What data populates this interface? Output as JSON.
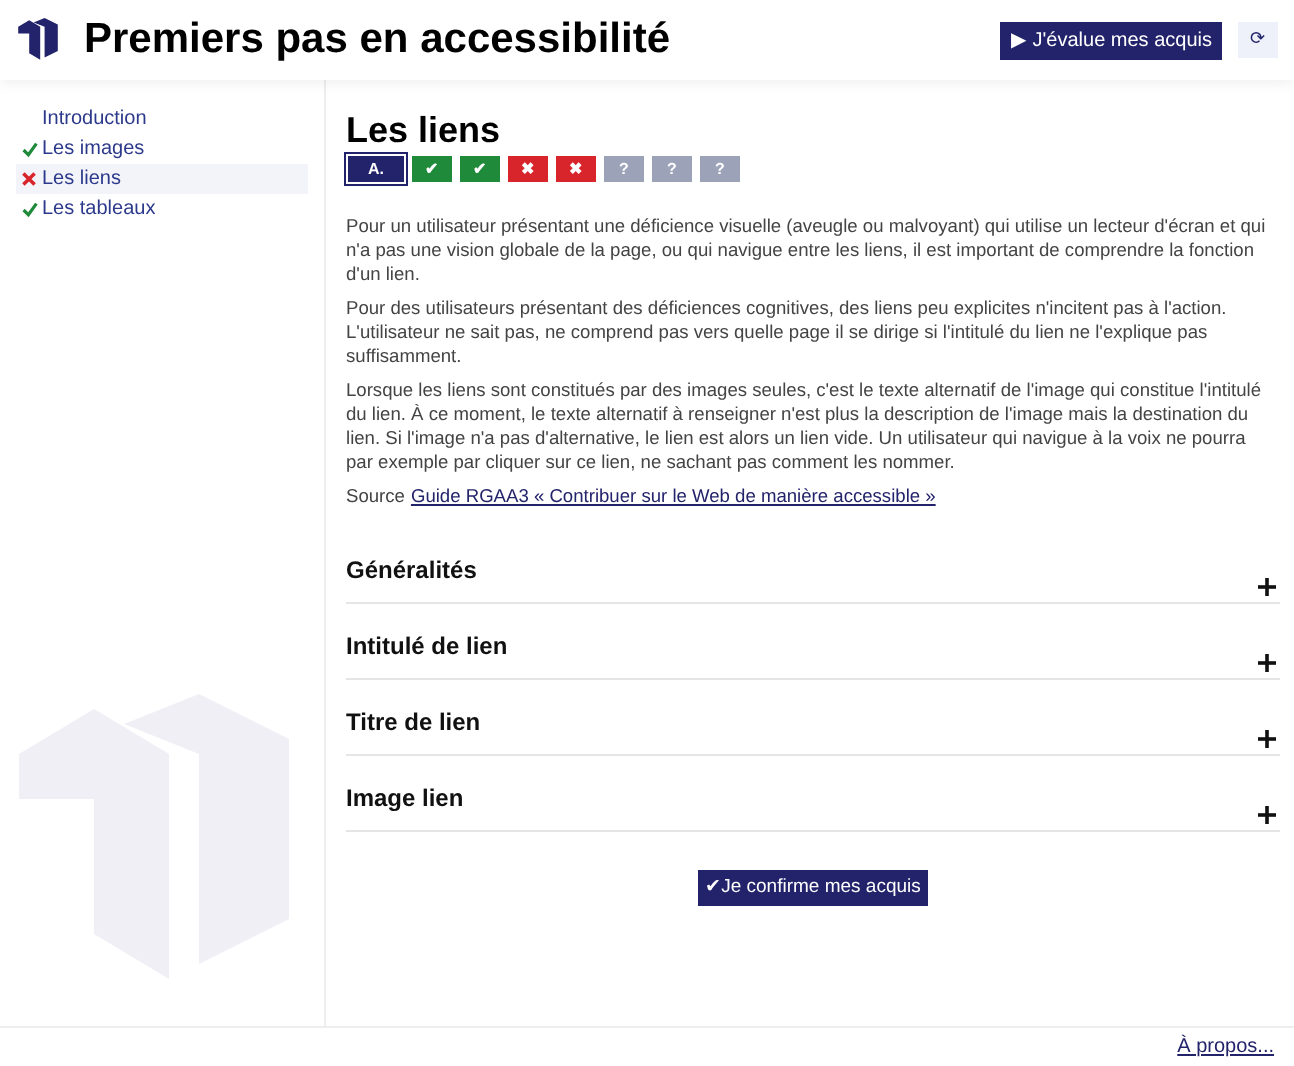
{
  "header": {
    "title": "Premiers pas en accessibilité",
    "evaluate_button": "▶ J'évalue mes acquis",
    "reset_button": "⟳"
  },
  "sidebar": {
    "items": [
      {
        "label": "Introduction",
        "kind": "plain",
        "selected": false
      },
      {
        "label": "Les images",
        "kind": "passed",
        "selected": false
      },
      {
        "label": "Les liens",
        "kind": "failed",
        "selected": true
      },
      {
        "label": "Les tableaux",
        "kind": "passed",
        "selected": false
      }
    ]
  },
  "main": {
    "title": "Les liens",
    "progress": [
      {
        "kind": "current",
        "text": "A."
      },
      {
        "kind": "pass",
        "text": "✔"
      },
      {
        "kind": "pass",
        "text": "✔"
      },
      {
        "kind": "fail",
        "text": "✖"
      },
      {
        "kind": "fail",
        "text": "✖"
      },
      {
        "kind": "unknown",
        "text": "?"
      },
      {
        "kind": "unknown",
        "text": "?"
      },
      {
        "kind": "unknown",
        "text": "?"
      }
    ],
    "paragraphs": [
      "Pour un utilisateur présentant une déficience visuelle (aveugle ou malvoyant) qui utilise un lecteur d'écran et qui n'a pas une vision globale de la page, ou qui navigue entre les liens, il est important de comprendre la fonction d'un lien.",
      "Pour des utilisateurs présentant des déficiences cognitives, des liens peu explicites n'incitent pas à l'action. L'utilisateur ne sait pas, ne comprend pas vers quelle page il se dirige si l'intitulé du lien ne l'explique pas suffisamment.",
      "Lorsque les liens sont constitués par des images seules, c'est le texte alternatif de l'image qui constitue l'intitulé du lien. À ce moment, le texte alternatif à renseigner n'est plus la description de l'image mais la destination du lien. Si l'image n'a pas d'alternative, le lien est alors un lien vide. Un utilisateur qui navigue à la voix ne pourra par exemple par cliquer sur ce lien, ne sachant pas comment les nommer."
    ],
    "source": {
      "label": "Source",
      "link": "Guide RGAA3 « Contribuer sur le Web de manière accessible »"
    },
    "sections": [
      {
        "title": "Généralités",
        "expanded": false
      },
      {
        "title": "Intitulé de lien",
        "expanded": false
      },
      {
        "title": "Titre de lien",
        "expanded": false
      },
      {
        "title": "Image lien",
        "expanded": false
      }
    ],
    "confirm_button": "✔Je confirme mes acquis"
  },
  "footer": {
    "link": "À propos..."
  }
}
